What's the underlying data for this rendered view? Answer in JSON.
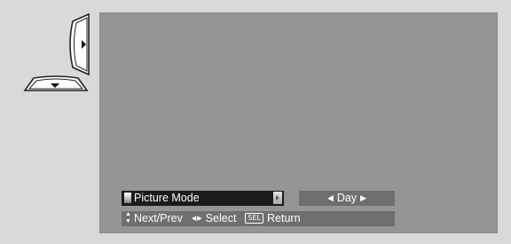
{
  "menu": {
    "item_label": "Picture Mode",
    "value": "Day"
  },
  "help": {
    "next_prev": "Next/Prev",
    "select": "Select",
    "sel_key": "SEL",
    "return": "Return"
  },
  "icons": {
    "right_wedge": "right-arrow-wedge-icon",
    "down_wedge": "down-arrow-wedge-icon"
  },
  "colors": {
    "background": "#d9d9d9",
    "screen": "#959595",
    "menu_highlight": "#1c1c1c",
    "osd_box": "#6f6f6f",
    "text": "#ffffff"
  }
}
